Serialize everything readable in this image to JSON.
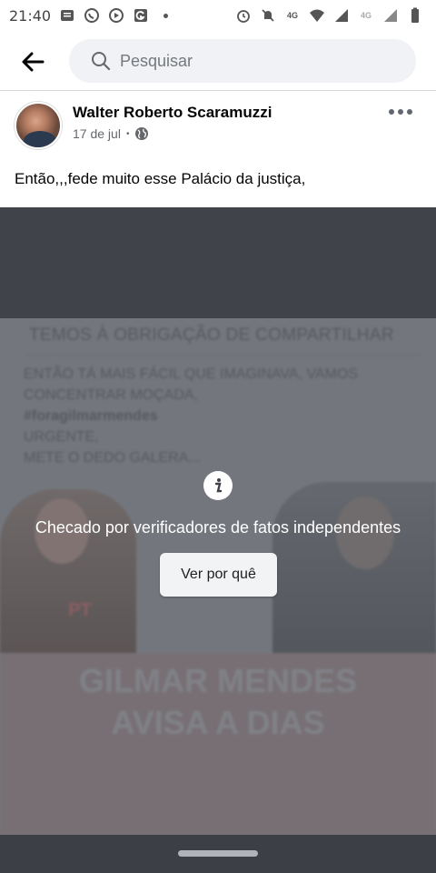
{
  "status_bar": {
    "time": "21:40",
    "network_label": "4G",
    "network_label_2": "4G",
    "icons": [
      "message-icon",
      "whatsapp-icon",
      "youtube-icon",
      "gmail-icon",
      "dot-icon",
      "alarm-icon",
      "mute-icon",
      "network-4g-icon",
      "wifi-icon",
      "signal-icon",
      "battery-icon"
    ]
  },
  "header": {
    "back_icon": "arrow-left-icon",
    "search_placeholder": "Pesquisar"
  },
  "post": {
    "author": "Walter Roberto Scaramuzzi",
    "date": "17 de jul",
    "date_separator": "•",
    "privacy_icon": "globe-icon",
    "text": "Então,,,fede muito esse Palácio da justiça,"
  },
  "media": {
    "image_title": "TEMOS À OBRIGAÇÃO DE COMPARTILHAR",
    "image_body_line1": "ENTÃO TÁ MAIS FÁCIL QUE IMAGINAVA, VAMOS",
    "image_body_line2": "CONCENTRAR MOÇADA,",
    "image_hashtag": "#foragilmarmendes",
    "image_body_line4": "URGENTE,",
    "image_body_line5": "METE O DEDO GALERA...",
    "image_badge": "PT",
    "banner_line1": "GILMAR MENDES",
    "banner_line2": "AVISA A DIAS",
    "fact_check_text": "Checado por verificadores de fatos independentes",
    "why_button": "Ver por quê"
  },
  "colors": {
    "overlay": "#73777d",
    "button_bg": "#f2f3f5",
    "search_bg": "#f0f2f5"
  }
}
